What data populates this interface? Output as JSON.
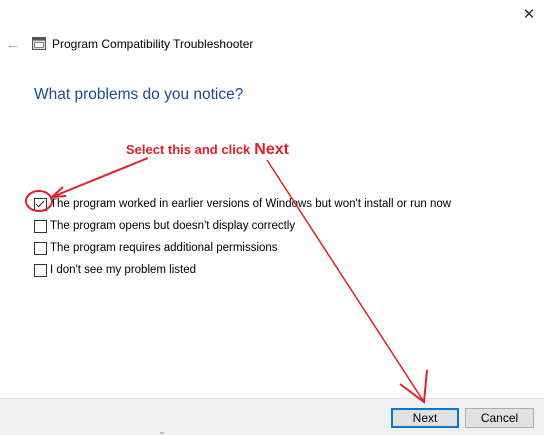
{
  "window": {
    "title": "Program Compatibility Troubleshooter",
    "back_icon": "left-arrow-icon",
    "close_icon": "close-icon",
    "close_glyph": "✕",
    "back_glyph": "←"
  },
  "main": {
    "heading": "What problems do you notice?",
    "options": [
      {
        "label": "The program worked in earlier versions of Windows but won't install or run now",
        "checked": true
      },
      {
        "label": "The program opens but doesn't display correctly",
        "checked": false
      },
      {
        "label": "The program requires additional permissions",
        "checked": false
      },
      {
        "label": "I don't see my problem listed",
        "checked": false
      }
    ]
  },
  "annotation": {
    "text": "Select this and click",
    "emphasis": "Next",
    "color": "#e0202a"
  },
  "footer": {
    "next_label": "Next",
    "cancel_label": "Cancel"
  },
  "colors": {
    "heading": "#1b4a9c",
    "default_button_border": "#0078d7"
  }
}
